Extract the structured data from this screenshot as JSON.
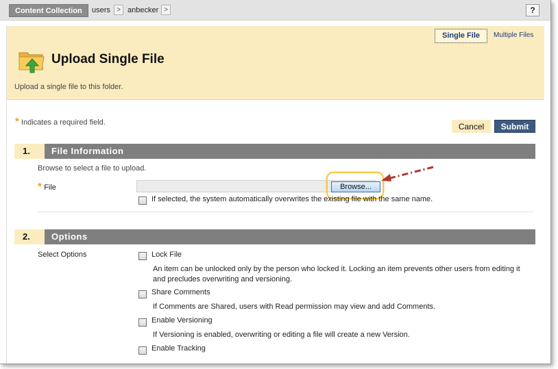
{
  "breadcrumb": {
    "root": "Content Collection",
    "items": [
      "users",
      "anbecker"
    ],
    "arrow": ">",
    "help": "?"
  },
  "header": {
    "mode_single": "Single File",
    "mode_multiple": "Multiple Files",
    "title": "Upload Single File",
    "description": "Upload a single file to this folder."
  },
  "required_note": "Indicates a required field.",
  "required_star": "*",
  "buttons": {
    "cancel": "Cancel",
    "submit": "Submit"
  },
  "section1": {
    "number": "1.",
    "title": "File Information",
    "instructions": "Browse to select a file to upload.",
    "file_label": "File",
    "browse_label": "Browse...",
    "overwrite_text": "If selected, the system automatically overwrites the existing file with the same name."
  },
  "section2": {
    "number": "2.",
    "title": "Options",
    "select_label": "Select Options",
    "options": [
      {
        "label": "Lock File",
        "desc": "An item can be unlocked only by the person who locked it. Locking an item prevents other users from editing it and precludes overwriting and versioning."
      },
      {
        "label": "Share Comments",
        "desc": "If Comments are Shared, users with Read permission may view and add Comments."
      },
      {
        "label": "Enable Versioning",
        "desc": "If Versioning is enabled, overwriting or editing a file will create a new Version."
      },
      {
        "label": "Enable Tracking",
        "desc": ""
      }
    ]
  },
  "colors": {
    "header_bg": "#fbecc0",
    "section_bar": "#7f7f7f",
    "submit_bg": "#3d5a80",
    "link": "#1a3c78",
    "required": "#f0a020",
    "annotation_arrow": "#b0392b"
  }
}
